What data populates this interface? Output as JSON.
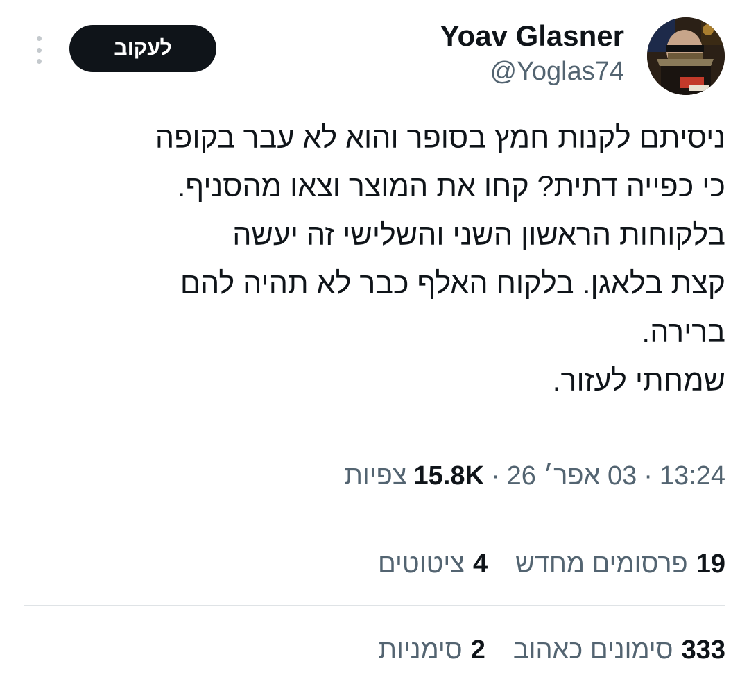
{
  "header": {
    "follow_label": "לעקוב",
    "display_name": "Yoav Glasner",
    "handle": "@Yoglas74"
  },
  "tweet": {
    "lines": [
      "ניסיתם לקנות חמץ בסופר והוא לא עבר בקופה",
      "כי כפייה דתית? קחו את המוצר וצאו מהסניף.",
      "בלקוחות הראשון השני והשלישי זה יעשה",
      "קצת בלאגן. בלקוח האלף כבר לא תהיה להם",
      "ברירה.",
      "שמחתי לעזור."
    ]
  },
  "meta": {
    "time": "13:24",
    "date": "03 אפר׳ 26",
    "views_count": "15.8K",
    "views_label": "צפיות",
    "separator": "·"
  },
  "stats": {
    "row1": [
      {
        "count": "19",
        "label": "פרסומים מחדש"
      },
      {
        "count": "4",
        "label": "ציטוטים"
      }
    ],
    "row2": [
      {
        "count": "333",
        "label": "סימונים כאהוב"
      },
      {
        "count": "2",
        "label": "סימניות"
      }
    ]
  }
}
